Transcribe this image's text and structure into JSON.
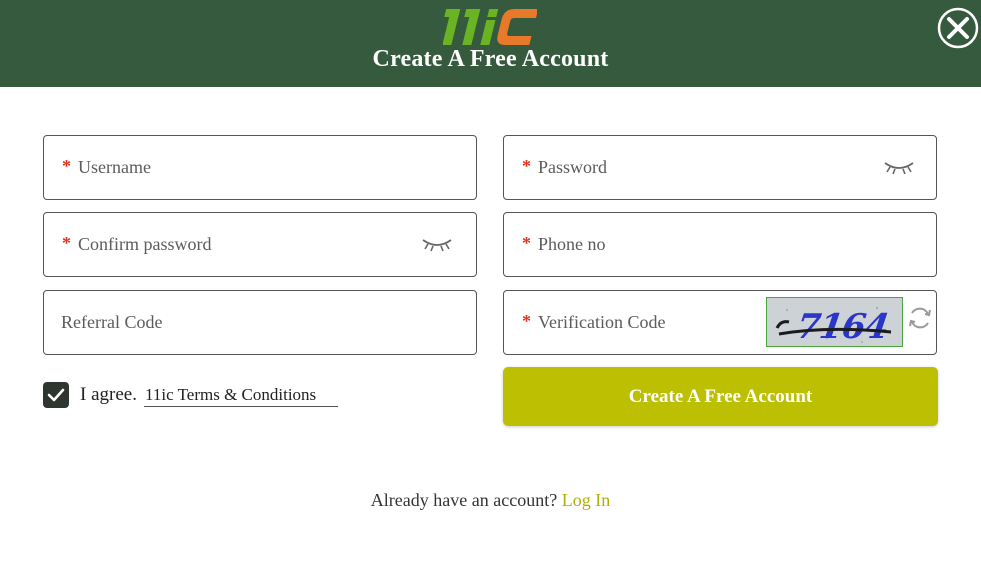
{
  "header": {
    "logo_text": "11ic",
    "title": "Create A Free Account",
    "colors": {
      "background": "#365a3e",
      "logo_green": "#6ab424",
      "logo_orange": "#e8792b"
    }
  },
  "form": {
    "required_mark": "*",
    "fields": {
      "username": {
        "placeholder": "Username",
        "required": true
      },
      "password": {
        "placeholder": "Password",
        "required": true,
        "icon": "eye-closed-icon"
      },
      "confirm_password": {
        "placeholder": "Confirm password",
        "required": true,
        "icon": "eye-closed-icon"
      },
      "phone": {
        "placeholder": "Phone no",
        "required": true
      },
      "referral": {
        "placeholder": "Referral Code",
        "required": false
      },
      "verification": {
        "placeholder": "Verification Code",
        "required": true,
        "captcha_text": "7164",
        "icon": "refresh-icon"
      }
    },
    "agree": {
      "checked": true,
      "label": "I agree.",
      "terms_link": "11ic Terms & Conditions"
    },
    "submit_label": "Create A Free Account",
    "colors": {
      "submit": "#bdbf02",
      "required": "#e0341f",
      "login_link": "#b3ad08"
    }
  },
  "footer": {
    "prompt": "Already have an account?",
    "login_link": "Log In"
  }
}
